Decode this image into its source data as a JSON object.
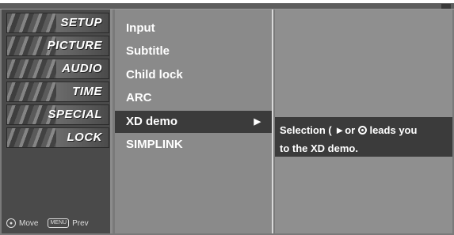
{
  "sidebar": {
    "items": [
      {
        "label": "SETUP",
        "icon": "setup-icon"
      },
      {
        "label": "PICTURE",
        "icon": "picture-icon"
      },
      {
        "label": "AUDIO",
        "icon": "audio-icon"
      },
      {
        "label": "TIME",
        "icon": "time-icon"
      },
      {
        "label": "SPECIAL",
        "icon": "special-icon"
      },
      {
        "label": "LOCK",
        "icon": "lock-icon"
      }
    ],
    "footer": {
      "move_label": "Move",
      "menu_key": "MENU",
      "prev_label": "Prev"
    }
  },
  "menu": {
    "items": [
      "Input",
      "Subtitle",
      "Child lock",
      "ARC",
      "XD demo",
      "SIMPLINK"
    ],
    "selected": "XD demo",
    "selected_arrow": "▶"
  },
  "description": {
    "line1_prefix": "Selection ( ►",
    "line1_middle": "or",
    "line1_suffix": "leads you",
    "line2": "to the XD demo."
  },
  "colors": {
    "background": "#7a7a7a",
    "highlight": "#3b3b3b",
    "text": "#ffffff"
  }
}
